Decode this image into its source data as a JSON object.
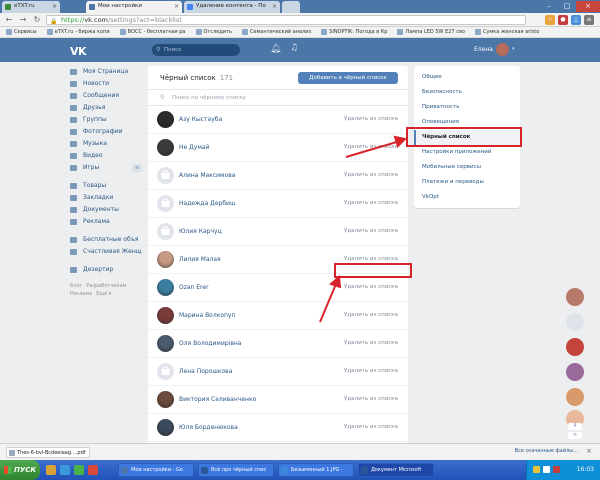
{
  "browser": {
    "tabs": [
      {
        "label": "eTXT.ru",
        "active": false,
        "color": "#3a8a3a"
      },
      {
        "label": "Мои настройки",
        "active": true,
        "color": "#4a76a8"
      },
      {
        "label": "Удаление контента - По",
        "active": false,
        "color": "#4285f4"
      },
      {
        "label": "",
        "active": false,
        "color": "#f2f2f2"
      }
    ],
    "url_protocol": "https://",
    "url_host": "vk.com",
    "url_path": "/settings?act=blacklist",
    "bookmarks": [
      "Сервисы",
      "eTXT.ru - биржа копи",
      "ВОСС - бесплатная ра",
      "Отследить",
      "Семантический анализ",
      "SINOPTIK: Погода в Кр",
      "Лампа LED 5W E27 сво",
      "Сумка женская aristo"
    ]
  },
  "vk": {
    "search_placeholder": "Поиск",
    "user_name": "Елена",
    "accent": "#4a76a8",
    "left_nav": [
      {
        "label": "Моя Страница",
        "icon": "home-icon"
      },
      {
        "label": "Новости",
        "icon": "news-icon"
      },
      {
        "label": "Сообщения",
        "icon": "messages-icon"
      },
      {
        "label": "Друзья",
        "icon": "friends-icon"
      },
      {
        "label": "Группы",
        "icon": "groups-icon"
      },
      {
        "label": "Фотографии",
        "icon": "photos-icon"
      },
      {
        "label": "Музыка",
        "icon": "music-icon"
      },
      {
        "label": "Видео",
        "icon": "video-icon"
      },
      {
        "label": "Игры",
        "icon": "games-icon"
      }
    ],
    "games_badge": "≡",
    "left_nav2": [
      {
        "label": "Товары",
        "icon": "goods-icon"
      },
      {
        "label": "Закладки",
        "icon": "bookmarks-icon"
      },
      {
        "label": "Документы",
        "icon": "documents-icon"
      },
      {
        "label": "Реклама",
        "icon": "ads-icon"
      }
    ],
    "left_nav3": [
      {
        "label": "Бесплатные объя",
        "icon": "ad-listings-icon"
      },
      {
        "label": "Счастливая Женщ",
        "icon": "community-icon"
      }
    ],
    "left_nav4": [
      {
        "label": "Дезертир",
        "icon": "app-icon"
      }
    ],
    "footer_links_1": [
      "Блог",
      "Разработчикам"
    ],
    "footer_links_2": [
      "Реклама",
      "Ещё ▾"
    ],
    "blacklist": {
      "title": "Чёрный список",
      "count": "171",
      "add_button": "Добавить в чёрный список",
      "search_placeholder": "Поиск по чёрному списку",
      "remove_label": "Удалить из списка",
      "rows": [
        {
          "name": "Азу Кыстауба",
          "avatar": "photo",
          "color": "#2b2b2b"
        },
        {
          "name": "Не Думай",
          "avatar": "photo",
          "color": "#3a3a3a"
        },
        {
          "name": "Алина Максимова",
          "avatar": "deleted",
          "color": "#e1e5eb"
        },
        {
          "name": "Надежда Дербиш",
          "avatar": "deleted",
          "color": "#e1e5eb"
        },
        {
          "name": "Юлия Карчуц",
          "avatar": "deleted",
          "color": "#e1e5eb"
        },
        {
          "name": "Лилия Малая",
          "avatar": "photo",
          "color": "#c79a83"
        },
        {
          "name": "Ozan Erer",
          "avatar": "photo",
          "color": "#3b7fa0"
        },
        {
          "name": "Марина Волкопуп",
          "avatar": "photo",
          "color": "#7a3b3b"
        },
        {
          "name": "Оля Володимирівна",
          "avatar": "photo",
          "color": "#4a5b6d"
        },
        {
          "name": "Лена Порошкова",
          "avatar": "deleted",
          "color": "#e1e5eb"
        },
        {
          "name": "Виктория Селиванченко",
          "avatar": "photo",
          "color": "#6b4b3b"
        },
        {
          "name": "Юля Борденюкова",
          "avatar": "photo",
          "color": "#3a4a5a"
        }
      ]
    },
    "settings_menu": [
      {
        "label": "Общее",
        "active": false
      },
      {
        "label": "Безопасность",
        "active": false
      },
      {
        "label": "Приватность",
        "active": false
      },
      {
        "label": "Оповещения",
        "active": false
      },
      {
        "label": "Чёрный список",
        "active": true
      },
      {
        "label": "Настройки приложений",
        "active": false
      },
      {
        "label": "Мобильные сервисы",
        "active": false
      },
      {
        "label": "Платежи и переводы",
        "active": false
      },
      {
        "label": "VkOpt",
        "active": false
      }
    ],
    "side_chats": [
      {
        "color": "#b77a6a"
      },
      {
        "color": "#dfe4ea"
      },
      {
        "color": "#c4443b"
      },
      {
        "color": "#9a6a9a"
      },
      {
        "color": "#d89a6a"
      },
      {
        "color": "#e8b89a"
      }
    ],
    "side_badge_1": "4",
    "side_badge_2": "≡"
  },
  "downloads": {
    "file": "Thes-6-bvl-Bcdeeiaag....pdf",
    "show_all": "Все скачанные файлы..."
  },
  "taskbar": {
    "start_label": "ПУСК",
    "tasks": [
      {
        "label": "Мои настройки - Go",
        "color": "#4a76a8",
        "active": false
      },
      {
        "label": "Всё про чёрный спис",
        "color": "#2b5797",
        "active": false
      },
      {
        "label": "Безымянный 1.JPG -",
        "color": "#3c8ad8",
        "active": false
      },
      {
        "label": "Документ Microsoft",
        "color": "#2b5797",
        "active": true
      }
    ],
    "time": "16:03"
  }
}
